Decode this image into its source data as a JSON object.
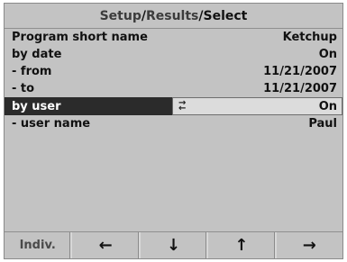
{
  "title": {
    "crumb1": "Setup",
    "sep": "/",
    "crumb2": "Results",
    "current": "Select"
  },
  "rows": [
    {
      "label": "Program short name",
      "value": "Ketchup"
    },
    {
      "label": "by date",
      "value": "On"
    },
    {
      "label": "- from",
      "value": "11/21/2007"
    },
    {
      "label": "- to",
      "value": "11/21/2007"
    },
    {
      "label": "by user",
      "value": "On",
      "selected": true,
      "icon": "toggle-arrows-icon"
    },
    {
      "label": "- user name",
      "value": "Paul"
    }
  ],
  "softkeys": [
    {
      "label": "Indiv."
    },
    {
      "glyph": "←",
      "icon": "arrow-left-icon"
    },
    {
      "glyph": "↓",
      "icon": "arrow-down-icon"
    },
    {
      "glyph": "↑",
      "icon": "arrow-up-icon"
    },
    {
      "glyph": "→",
      "icon": "arrow-right-icon"
    }
  ],
  "colors": {
    "background": "#c3c3c3",
    "selection": "#2b2b2b",
    "field": "#dcdcdc"
  }
}
